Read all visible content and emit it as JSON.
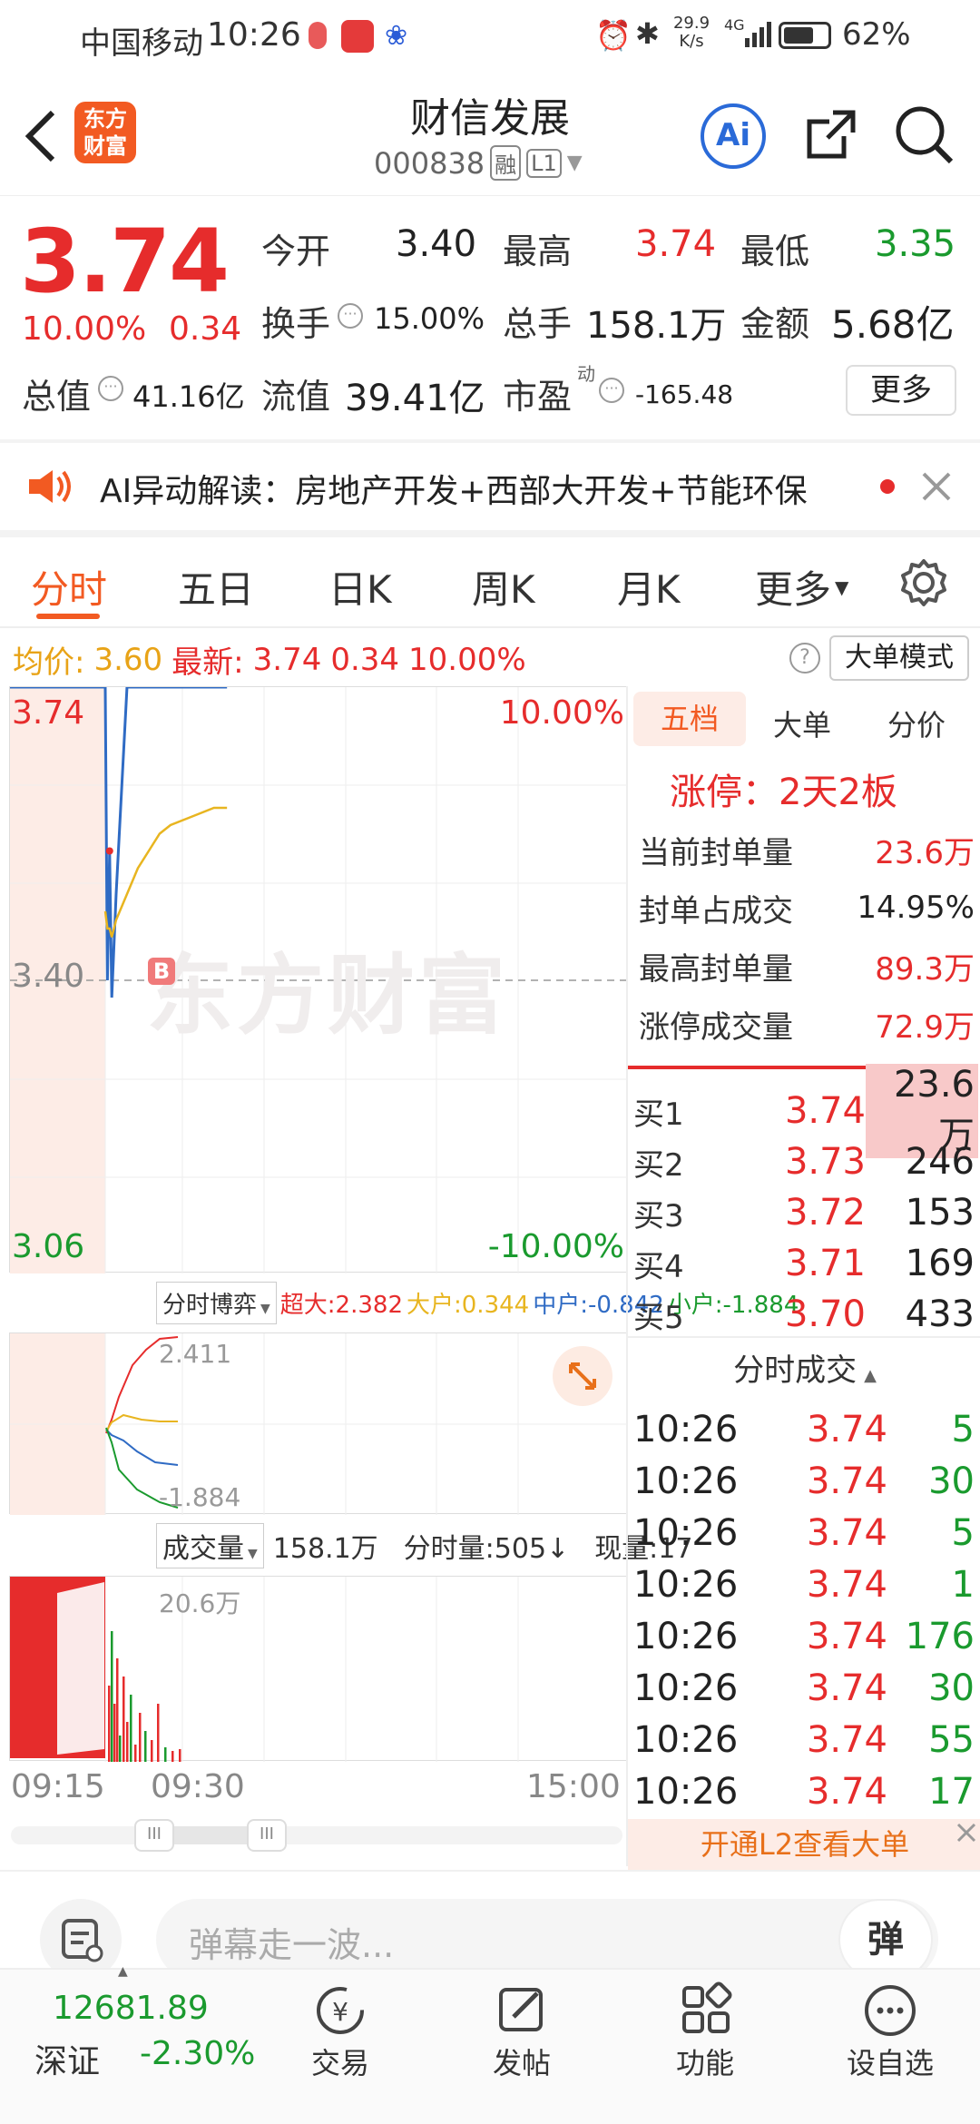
{
  "status": {
    "carrier": "中国移动",
    "time": "10:26",
    "net_speed": "29.9",
    "net_unit": "K/s",
    "signal": "4G",
    "battery": "62%"
  },
  "header": {
    "logo_line1": "东方",
    "logo_line2": "财富",
    "title": "财信发展",
    "code": "000838",
    "tag_rong": "融",
    "tag_l1": "L1",
    "ai_label": "Ai"
  },
  "quote": {
    "price": "3.74",
    "change_pct": "10.00%",
    "change": "0.34",
    "open_label": "今开",
    "open": "3.40",
    "high_label": "最高",
    "high": "3.74",
    "low_label": "最低",
    "low": "3.35",
    "turnover_label": "换手",
    "turnover": "15.00%",
    "vol_label": "总手",
    "vol": "158.1万",
    "amount_label": "金额",
    "amount": "5.68亿",
    "mktcap_label": "总值",
    "mktcap": "41.16亿",
    "float_label": "流值",
    "float": "39.41亿",
    "pe_label": "市盈",
    "pe_sup": "动",
    "pe": "-165.48",
    "more": "更多"
  },
  "ai_banner": {
    "text": "AI异动解读：房地产开发+西部大开发+节能环保"
  },
  "tabs": [
    "分时",
    "五日",
    "日K",
    "周K",
    "月K",
    "更多"
  ],
  "active_tab": 0,
  "info_line": {
    "avg_label": "均价:",
    "avg": "3.60",
    "last_label": "最新:",
    "last": "3.74",
    "chg": "0.34",
    "pct": "10.00%",
    "mode_btn": "大单模式"
  },
  "chart": {
    "y_top": "3.74",
    "y_mid": "3.40",
    "y_bot": "3.06",
    "pct_top": "10.00%",
    "pct_bot": "-10.00%",
    "marker": "B",
    "watermark": "东方财富",
    "game_label": "分时博弈",
    "super_label": "超大:2.382",
    "big_label": "大户:0.344",
    "mid_label": "中户:-0.842",
    "small_label": "小户:-1.884",
    "game_top": "2.411",
    "game_bot": "-1.884",
    "vol_label": "成交量",
    "vol_total": "158.1万",
    "vol_step": "分时量:505↓",
    "vol_now": "现量:17",
    "vol_max": "20.6万",
    "t_start": "09:15",
    "t_mid": "09:30",
    "t_end": "15:00",
    "colors": {
      "up": "#e62c2c",
      "down": "#1a9a2e",
      "price": "#2f6bc4",
      "avg": "#e8b520",
      "pre": "#fdece6"
    }
  },
  "chart_data": {
    "type": "line",
    "x": [
      "09:15",
      "09:25",
      "09:30",
      "09:31",
      "09:32",
      "09:33",
      "09:35",
      "09:40",
      "09:45",
      "09:50",
      "09:55",
      "10:00",
      "10:10",
      "10:20",
      "10:26"
    ],
    "series": [
      {
        "name": "price",
        "values": [
          3.74,
          3.74,
          3.74,
          3.4,
          3.55,
          3.38,
          3.5,
          3.74,
          3.74,
          3.74,
          3.74,
          3.74,
          3.74,
          3.74,
          3.74
        ]
      },
      {
        "name": "均价",
        "values": [
          null,
          null,
          3.48,
          3.46,
          3.46,
          3.45,
          3.47,
          3.5,
          3.53,
          3.55,
          3.57,
          3.58,
          3.59,
          3.6,
          3.6
        ]
      }
    ],
    "ylim": [
      3.06,
      3.74
    ]
  },
  "side": {
    "tabs": [
      "五档",
      "大单",
      "分价"
    ],
    "limit_title": "涨停：2天2板",
    "stats": [
      {
        "label": "当前封单量",
        "value": "23.6万",
        "red": true
      },
      {
        "label": "封单占成交",
        "value": "14.95%",
        "red": false
      },
      {
        "label": "最高封单量",
        "value": "89.3万",
        "red": true
      },
      {
        "label": "涨停成交量",
        "value": "72.9万",
        "red": true
      }
    ],
    "bids": [
      {
        "label": "买1",
        "price": "3.74",
        "vol": "23.6万"
      },
      {
        "label": "买2",
        "price": "3.73",
        "vol": "246"
      },
      {
        "label": "买3",
        "price": "3.72",
        "vol": "153"
      },
      {
        "label": "买4",
        "price": "3.71",
        "vol": "169"
      },
      {
        "label": "买5",
        "price": "3.70",
        "vol": "433"
      }
    ],
    "ticks_title": "分时成交",
    "ticks": [
      {
        "t": "10:26",
        "p": "3.74",
        "v": "5"
      },
      {
        "t": "10:26",
        "p": "3.74",
        "v": "30"
      },
      {
        "t": "10:26",
        "p": "3.74",
        "v": "5"
      },
      {
        "t": "10:26",
        "p": "3.74",
        "v": "1"
      },
      {
        "t": "10:26",
        "p": "3.74",
        "v": "176"
      },
      {
        "t": "10:26",
        "p": "3.74",
        "v": "30"
      },
      {
        "t": "10:26",
        "p": "3.74",
        "v": "55"
      },
      {
        "t": "10:26",
        "p": "3.74",
        "v": "17"
      }
    ],
    "l2_banner": "开通L2查看大单"
  },
  "comment": {
    "placeholder": "弹幕走一波...",
    "btn": "弹"
  },
  "bottom": {
    "index_value": "12681.89",
    "index_name": "深证",
    "index_pct": "-2.30%",
    "items": [
      "交易",
      "发帖",
      "功能",
      "设自选"
    ]
  }
}
